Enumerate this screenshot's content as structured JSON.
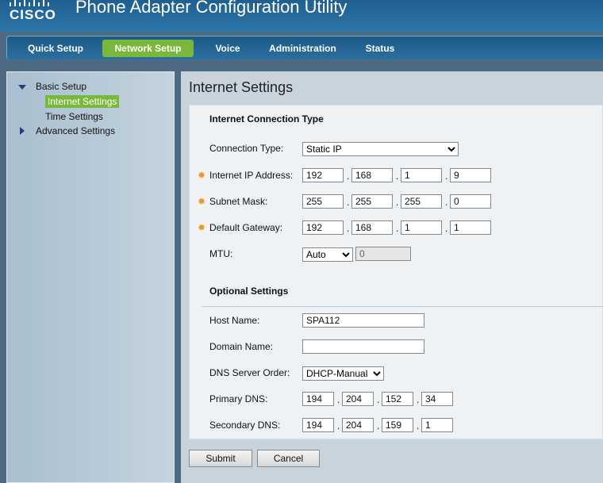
{
  "header": {
    "brand": "CISCO",
    "title": "Phone Adapter Configuration Utility"
  },
  "nav": {
    "tabs": [
      {
        "label": "Quick Setup"
      },
      {
        "label": "Network Setup",
        "active": true
      },
      {
        "label": "Voice"
      },
      {
        "label": "Administration"
      },
      {
        "label": "Status"
      }
    ]
  },
  "sidebar": {
    "basic_setup": "Basic Setup",
    "internet_settings": "Internet Settings",
    "time_settings": "Time Settings",
    "advanced_settings": "Advanced Settings"
  },
  "page": {
    "title": "Internet Settings",
    "connection_section": "Internet Connection Type",
    "connection_type_label": "Connection Type:",
    "connection_type_value": "Static IP",
    "ip_label": "Internet IP Address:",
    "ip": [
      "192",
      "168",
      "1",
      "9"
    ],
    "subnet_label": "Subnet Mask:",
    "subnet": [
      "255",
      "255",
      "255",
      "0"
    ],
    "gateway_label": "Default Gateway:",
    "gateway": [
      "192",
      "168",
      "1",
      "1"
    ],
    "mtu_label": "MTU:",
    "mtu_mode": "Auto",
    "mtu_value": "0",
    "optional_section": "Optional Settings",
    "host_label": "Host Name:",
    "host_value": "SPA112",
    "domain_label": "Domain Name:",
    "domain_value": "",
    "dns_order_label": "DNS Server Order:",
    "dns_order_value": "DHCP-Manual",
    "primary_dns_label": "Primary DNS:",
    "primary_dns": [
      "194",
      "204",
      "152",
      "34"
    ],
    "secondary_dns_label": "Secondary DNS:",
    "secondary_dns": [
      "194",
      "204",
      "159",
      "1"
    ]
  },
  "buttons": {
    "submit": "Submit",
    "cancel": "Cancel"
  },
  "colors": {
    "accent": "#79b83a",
    "header": "#2d75a8",
    "required_star": "#e89a1a"
  }
}
